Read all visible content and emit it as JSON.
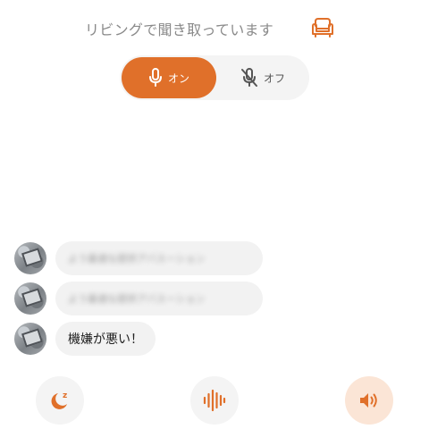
{
  "header": {
    "title": "リビングで聞き取っています",
    "room_icon": "armchair-icon"
  },
  "mic_toggle": {
    "on_label": "オン",
    "off_label": "オフ",
    "selected": "on"
  },
  "messages": [
    {
      "text": "よう最適な提供アバスーション",
      "blurred": true
    },
    {
      "text": "よう最適な提供アバスーション",
      "blurred": true
    },
    {
      "text": "機嫌が悪い！",
      "blurred": false
    }
  ],
  "bottom_bar": {
    "left_icon": "sleep-moon-icon",
    "center_icon": "sound-wave-icon",
    "right_icon": "speaker-volume-icon",
    "right_active": true
  },
  "colors": {
    "accent": "#e0702a",
    "accent_light": "#fbe5d6",
    "bubble_bg": "#f2f2f2"
  }
}
